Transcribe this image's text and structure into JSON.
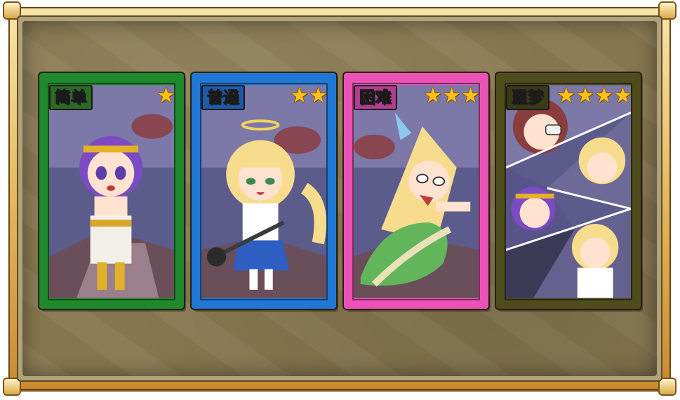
{
  "colors": {
    "easy": "#1f8a2c",
    "normal": "#2178d4",
    "hard": "#ea53b5",
    "nightmare": "#4e4c1c",
    "star": "#ffc21a"
  },
  "difficulties": [
    {
      "label": "简单",
      "stars": 1,
      "star_glyphs": "★",
      "icon": "star-icon"
    },
    {
      "label": "普通",
      "stars": 2,
      "star_glyphs": "★★",
      "icon": "star-icon"
    },
    {
      "label": "困难",
      "stars": 3,
      "star_glyphs": "★★★",
      "icon": "star-icon"
    },
    {
      "label": "噩梦",
      "stars": 4,
      "star_glyphs": "★★★★",
      "icon": "star-icon"
    }
  ]
}
